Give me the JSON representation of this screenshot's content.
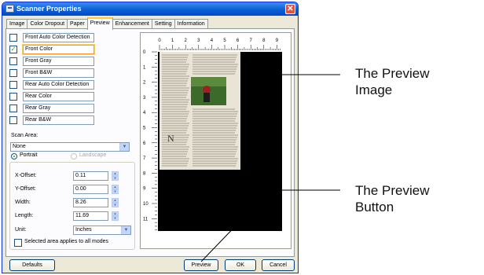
{
  "window": {
    "title": "Scanner Properties"
  },
  "tabs": [
    {
      "label": "Image"
    },
    {
      "label": "Color Dropout"
    },
    {
      "label": "Paper"
    },
    {
      "label": "Preview"
    },
    {
      "label": "Enhancement"
    },
    {
      "label": "Setting"
    },
    {
      "label": "Information"
    }
  ],
  "image_types": [
    {
      "label": "Front Auto Color Detection",
      "checked": false
    },
    {
      "label": "Front Color",
      "checked": true
    },
    {
      "label": "Front Gray",
      "checked": false
    },
    {
      "label": "Front B&W",
      "checked": false
    },
    {
      "label": "Rear Auto Color Detection",
      "checked": false
    },
    {
      "label": "Rear Color",
      "checked": false
    },
    {
      "label": "Rear Gray",
      "checked": false
    },
    {
      "label": "Rear B&W",
      "checked": false
    }
  ],
  "scan_area": {
    "label": "Scan Area:",
    "value": "None"
  },
  "orientation": {
    "portrait": "Portrait",
    "landscape": "Landscape",
    "selected": "Portrait"
  },
  "fields": [
    {
      "label": "X-Offset:",
      "value": "0.11"
    },
    {
      "label": "Y-Offset:",
      "value": "0.00"
    },
    {
      "label": "Width:",
      "value": "8.26"
    },
    {
      "label": "Length:",
      "value": "11.69"
    }
  ],
  "unit": {
    "label": "Unit:",
    "value": "Inches"
  },
  "apply_all": {
    "label": "Selected area applies to all modes",
    "checked": false
  },
  "ruler": {
    "top_ticks": [
      "0",
      "1",
      "2",
      "3",
      "4",
      "5",
      "6",
      "7",
      "8",
      "9"
    ],
    "left_ticks": [
      "0",
      "1",
      "2",
      "3",
      "4",
      "5",
      "6",
      "7",
      "8",
      "9",
      "10",
      "11"
    ]
  },
  "buttons": {
    "defaults": "Defaults",
    "preview": "Preview",
    "ok": "OK",
    "cancel": "Cancel"
  },
  "callouts": {
    "preview_image": [
      "The Preview",
      "Image"
    ],
    "preview_button": [
      "The Preview",
      "Button"
    ]
  },
  "colors": {
    "title_bar": "#0a5fd6",
    "panel_bg": "#ece9d8",
    "check_green": "#21a121"
  }
}
